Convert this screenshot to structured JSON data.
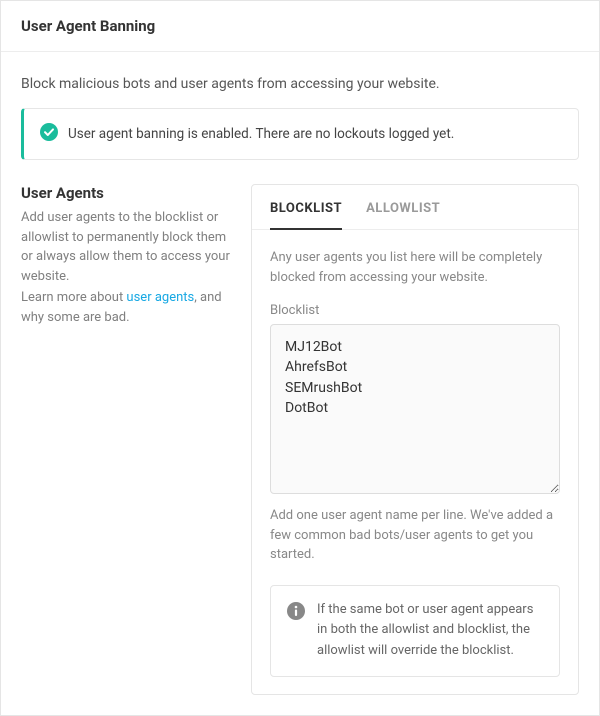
{
  "header": {
    "title": "User Agent Banning"
  },
  "intro": "Block malicious bots and user agents from accessing your website.",
  "notice": {
    "text": "User agent banning is enabled. There are no lockouts logged yet."
  },
  "sidebar": {
    "heading": "User Agents",
    "desc": "Add user agents to the blocklist or allowlist to permanently block them or always allow them to access your website.",
    "learn_pre": "Learn more about ",
    "learn_link": "user agents",
    "learn_post": ", and why some are bad."
  },
  "tabs": {
    "blocklist": "BLOCKLIST",
    "allowlist": "ALLOWLIST"
  },
  "blocklist": {
    "desc": "Any user agents you list here will be completely blocked from accessing your website.",
    "label": "Blocklist",
    "value": "MJ12Bot\nAhrefsBot\nSEMrushBot\nDotBot",
    "hint": "Add one user agent name per line. We've added a few common bad bots/user agents to get you started."
  },
  "info": {
    "text": "If the same bot or user agent appears in both the allowlist and blocklist, the allowlist will override the blocklist."
  }
}
